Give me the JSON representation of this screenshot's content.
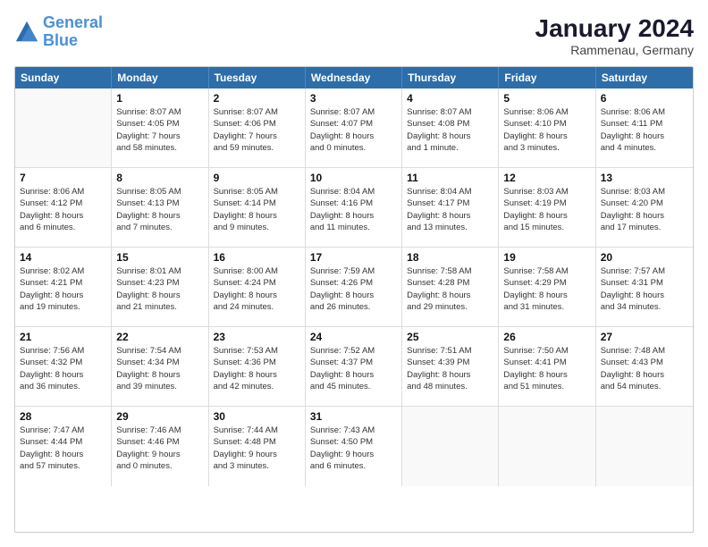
{
  "logo": {
    "line1": "General",
    "line2": "Blue"
  },
  "title": "January 2024",
  "subtitle": "Rammenau, Germany",
  "days": [
    "Sunday",
    "Monday",
    "Tuesday",
    "Wednesday",
    "Thursday",
    "Friday",
    "Saturday"
  ],
  "weeks": [
    [
      {
        "day": "",
        "sunrise": "",
        "sunset": "",
        "daylight": ""
      },
      {
        "day": "1",
        "sunrise": "Sunrise: 8:07 AM",
        "sunset": "Sunset: 4:05 PM",
        "daylight": "Daylight: 7 hours and 58 minutes."
      },
      {
        "day": "2",
        "sunrise": "Sunrise: 8:07 AM",
        "sunset": "Sunset: 4:06 PM",
        "daylight": "Daylight: 7 hours and 59 minutes."
      },
      {
        "day": "3",
        "sunrise": "Sunrise: 8:07 AM",
        "sunset": "Sunset: 4:07 PM",
        "daylight": "Daylight: 8 hours and 0 minutes."
      },
      {
        "day": "4",
        "sunrise": "Sunrise: 8:07 AM",
        "sunset": "Sunset: 4:08 PM",
        "daylight": "Daylight: 8 hours and 1 minute."
      },
      {
        "day": "5",
        "sunrise": "Sunrise: 8:06 AM",
        "sunset": "Sunset: 4:10 PM",
        "daylight": "Daylight: 8 hours and 3 minutes."
      },
      {
        "day": "6",
        "sunrise": "Sunrise: 8:06 AM",
        "sunset": "Sunset: 4:11 PM",
        "daylight": "Daylight: 8 hours and 4 minutes."
      }
    ],
    [
      {
        "day": "7",
        "sunrise": "Sunrise: 8:06 AM",
        "sunset": "Sunset: 4:12 PM",
        "daylight": "Daylight: 8 hours and 6 minutes."
      },
      {
        "day": "8",
        "sunrise": "Sunrise: 8:05 AM",
        "sunset": "Sunset: 4:13 PM",
        "daylight": "Daylight: 8 hours and 7 minutes."
      },
      {
        "day": "9",
        "sunrise": "Sunrise: 8:05 AM",
        "sunset": "Sunset: 4:14 PM",
        "daylight": "Daylight: 8 hours and 9 minutes."
      },
      {
        "day": "10",
        "sunrise": "Sunrise: 8:04 AM",
        "sunset": "Sunset: 4:16 PM",
        "daylight": "Daylight: 8 hours and 11 minutes."
      },
      {
        "day": "11",
        "sunrise": "Sunrise: 8:04 AM",
        "sunset": "Sunset: 4:17 PM",
        "daylight": "Daylight: 8 hours and 13 minutes."
      },
      {
        "day": "12",
        "sunrise": "Sunrise: 8:03 AM",
        "sunset": "Sunset: 4:19 PM",
        "daylight": "Daylight: 8 hours and 15 minutes."
      },
      {
        "day": "13",
        "sunrise": "Sunrise: 8:03 AM",
        "sunset": "Sunset: 4:20 PM",
        "daylight": "Daylight: 8 hours and 17 minutes."
      }
    ],
    [
      {
        "day": "14",
        "sunrise": "Sunrise: 8:02 AM",
        "sunset": "Sunset: 4:21 PM",
        "daylight": "Daylight: 8 hours and 19 minutes."
      },
      {
        "day": "15",
        "sunrise": "Sunrise: 8:01 AM",
        "sunset": "Sunset: 4:23 PM",
        "daylight": "Daylight: 8 hours and 21 minutes."
      },
      {
        "day": "16",
        "sunrise": "Sunrise: 8:00 AM",
        "sunset": "Sunset: 4:24 PM",
        "daylight": "Daylight: 8 hours and 24 minutes."
      },
      {
        "day": "17",
        "sunrise": "Sunrise: 7:59 AM",
        "sunset": "Sunset: 4:26 PM",
        "daylight": "Daylight: 8 hours and 26 minutes."
      },
      {
        "day": "18",
        "sunrise": "Sunrise: 7:58 AM",
        "sunset": "Sunset: 4:28 PM",
        "daylight": "Daylight: 8 hours and 29 minutes."
      },
      {
        "day": "19",
        "sunrise": "Sunrise: 7:58 AM",
        "sunset": "Sunset: 4:29 PM",
        "daylight": "Daylight: 8 hours and 31 minutes."
      },
      {
        "day": "20",
        "sunrise": "Sunrise: 7:57 AM",
        "sunset": "Sunset: 4:31 PM",
        "daylight": "Daylight: 8 hours and 34 minutes."
      }
    ],
    [
      {
        "day": "21",
        "sunrise": "Sunrise: 7:56 AM",
        "sunset": "Sunset: 4:32 PM",
        "daylight": "Daylight: 8 hours and 36 minutes."
      },
      {
        "day": "22",
        "sunrise": "Sunrise: 7:54 AM",
        "sunset": "Sunset: 4:34 PM",
        "daylight": "Daylight: 8 hours and 39 minutes."
      },
      {
        "day": "23",
        "sunrise": "Sunrise: 7:53 AM",
        "sunset": "Sunset: 4:36 PM",
        "daylight": "Daylight: 8 hours and 42 minutes."
      },
      {
        "day": "24",
        "sunrise": "Sunrise: 7:52 AM",
        "sunset": "Sunset: 4:37 PM",
        "daylight": "Daylight: 8 hours and 45 minutes."
      },
      {
        "day": "25",
        "sunrise": "Sunrise: 7:51 AM",
        "sunset": "Sunset: 4:39 PM",
        "daylight": "Daylight: 8 hours and 48 minutes."
      },
      {
        "day": "26",
        "sunrise": "Sunrise: 7:50 AM",
        "sunset": "Sunset: 4:41 PM",
        "daylight": "Daylight: 8 hours and 51 minutes."
      },
      {
        "day": "27",
        "sunrise": "Sunrise: 7:48 AM",
        "sunset": "Sunset: 4:43 PM",
        "daylight": "Daylight: 8 hours and 54 minutes."
      }
    ],
    [
      {
        "day": "28",
        "sunrise": "Sunrise: 7:47 AM",
        "sunset": "Sunset: 4:44 PM",
        "daylight": "Daylight: 8 hours and 57 minutes."
      },
      {
        "day": "29",
        "sunrise": "Sunrise: 7:46 AM",
        "sunset": "Sunset: 4:46 PM",
        "daylight": "Daylight: 9 hours and 0 minutes."
      },
      {
        "day": "30",
        "sunrise": "Sunrise: 7:44 AM",
        "sunset": "Sunset: 4:48 PM",
        "daylight": "Daylight: 9 hours and 3 minutes."
      },
      {
        "day": "31",
        "sunrise": "Sunrise: 7:43 AM",
        "sunset": "Sunset: 4:50 PM",
        "daylight": "Daylight: 9 hours and 6 minutes."
      },
      {
        "day": "",
        "sunrise": "",
        "sunset": "",
        "daylight": ""
      },
      {
        "day": "",
        "sunrise": "",
        "sunset": "",
        "daylight": ""
      },
      {
        "day": "",
        "sunrise": "",
        "sunset": "",
        "daylight": ""
      }
    ]
  ]
}
